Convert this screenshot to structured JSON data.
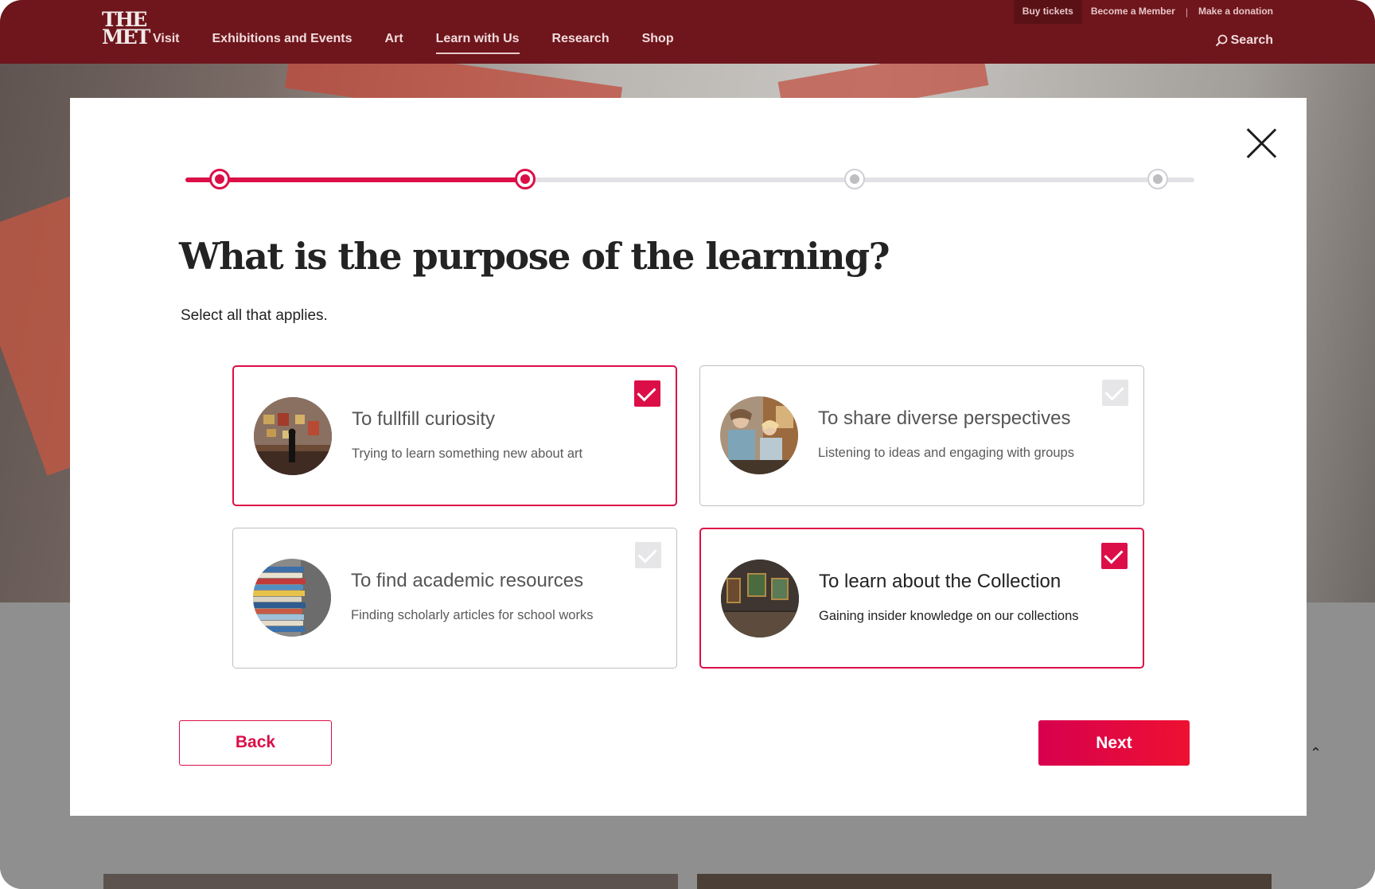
{
  "header": {
    "logo_line1": "THE",
    "logo_line2": "MET",
    "nav": [
      "Visit",
      "Exhibitions and Events",
      "Art",
      "Learn with Us",
      "Research",
      "Shop"
    ],
    "active_nav": "Learn with Us",
    "utility": {
      "buy_tickets": "Buy tickets",
      "become_member": "Become a Member",
      "separator": "|",
      "donate": "Make a donation"
    },
    "search_label": "Search"
  },
  "modal": {
    "progress": {
      "steps_total": 4,
      "current_step": 2
    },
    "title": "What is the purpose of the learning?",
    "subtitle": "Select all that applies.",
    "options": [
      {
        "title": "To fullfill curiosity",
        "description": "Trying to learn something new about art",
        "selected": true,
        "image": "gallery-visitor-photo"
      },
      {
        "title": "To share diverse perspectives",
        "description": "Listening to ideas and engaging with groups",
        "selected": false,
        "image": "group-discussion-photo"
      },
      {
        "title": "To find academic resources",
        "description": "Finding scholarly articles for school works",
        "selected": false,
        "image": "book-stack-photo"
      },
      {
        "title": "To learn about the Collection",
        "description": "Gaining insider knowledge on our collections",
        "selected": true,
        "image": "gallery-room-photo"
      }
    ],
    "back_label": "Back",
    "next_label": "Next"
  },
  "colors": {
    "header_bg": "#6e161c",
    "accent": "#dc0e48",
    "track": "#e2e2e6"
  }
}
